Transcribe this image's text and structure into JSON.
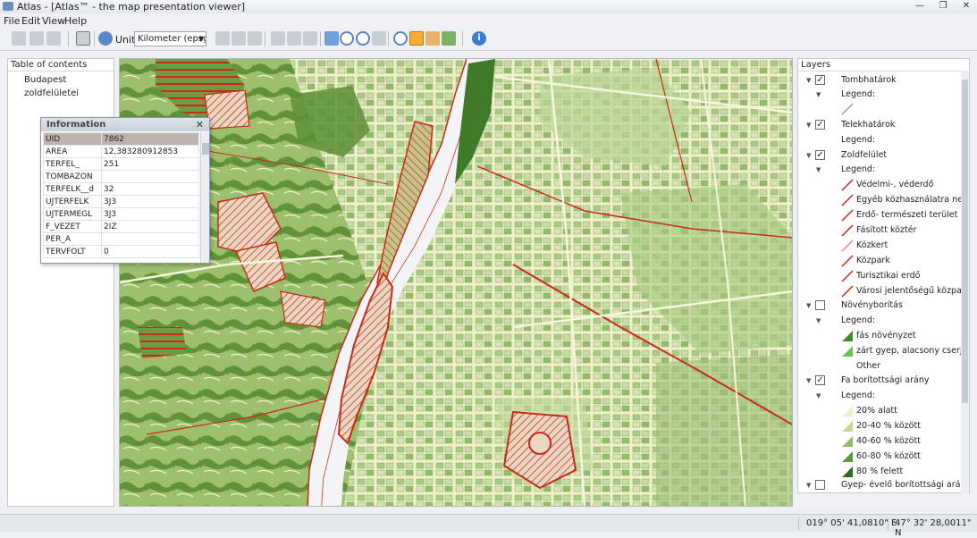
{
  "window": {
    "title": "Atlas - [Atlas™ - the map presentation viewer]"
  },
  "menu": [
    "File",
    "Edit",
    "View",
    "Help"
  ],
  "toolbar": {
    "unit_label": "Unit:",
    "unit_value": "Kilometer (epsg:"
  },
  "toc": {
    "header": "Table of contents",
    "items": [
      "Budapest zoldfelületei"
    ]
  },
  "info": {
    "title": "Information",
    "rows": [
      {
        "key": "UID",
        "value": "7862"
      },
      {
        "key": "AREA",
        "value": "12,383280912853"
      },
      {
        "key": "TERFEL_",
        "value": "251"
      },
      {
        "key": "TOMBAZON",
        "value": ""
      },
      {
        "key": "TERFELK__d",
        "value": "32"
      },
      {
        "key": "UJTERFELK",
        "value": "3J3"
      },
      {
        "key": "UJTERMEGL",
        "value": "3J3"
      },
      {
        "key": "F_VEZET",
        "value": "2IZ"
      },
      {
        "key": "PER_A",
        "value": ""
      },
      {
        "key": "TERVFOLT",
        "value": "0"
      }
    ]
  },
  "layers": {
    "header": "Layers",
    "legend_label": "Legend:",
    "groups": [
      {
        "name": "Tombhatárok",
        "checked": true,
        "items": []
      },
      {
        "name": "Telekhatárok",
        "checked": true,
        "items": []
      },
      {
        "name": "Zoldfelület",
        "checked": true,
        "items": [
          "Védelmi-, véderdő",
          "Egyéb közhasználatra nem sz",
          "Erdő- természeti terület",
          "Fásított köztér",
          "Közkert",
          "Közpark",
          "Turisztikai erdő",
          "Városi jelentőségű közpark"
        ]
      },
      {
        "name": "Növényborítás",
        "checked": false,
        "items": [
          "fás növényzet",
          "zárt gyep, alacsony cserje",
          "Other"
        ]
      },
      {
        "name": "Fa borítottsági arány",
        "checked": true,
        "items": [
          "20% alatt",
          "20-40 % között",
          "40-60 % között",
          "60-80 % között",
          "80 % felett"
        ]
      },
      {
        "name": "Gyep- évelő borítottsági arány",
        "checked": false,
        "items": []
      }
    ]
  },
  "status": {
    "longitude": "019° 05' 41,0810\" E",
    "latitude": "47° 32' 28,0011\" N"
  },
  "colors": {
    "map_bg": "#f3f2cc",
    "river": "#f4f4f6",
    "green_light": "#b7d28f",
    "green_mid": "#8fb96a",
    "green_dark": "#4f8a33",
    "red": "#d12a1a"
  }
}
